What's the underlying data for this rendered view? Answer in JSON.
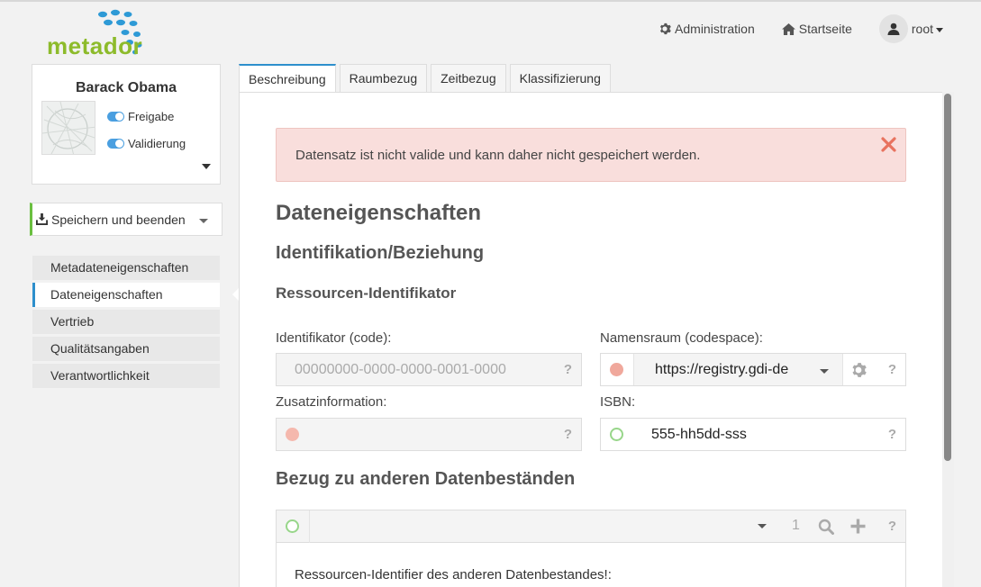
{
  "brand": {
    "name": "metador",
    "color": "#8dbb2b",
    "dot_color": "#2e9ad6"
  },
  "header": {
    "admin_label": "Administration",
    "home_label": "Startseite",
    "user_label": "root"
  },
  "profile": {
    "name": "Barack Obama",
    "toggle_release": "Freigabe",
    "toggle_validation": "Validierung"
  },
  "save_button": {
    "label": "Speichern und beenden"
  },
  "sidebar": {
    "items": [
      {
        "label": "Metadateneigenschaften"
      },
      {
        "label": "Dateneigenschaften"
      },
      {
        "label": "Vertrieb"
      },
      {
        "label": "Qualitätsangaben"
      },
      {
        "label": "Verantwortlichkeit"
      }
    ],
    "active_index": 1
  },
  "tabs": [
    {
      "label": "Beschreibung"
    },
    {
      "label": "Raumbezug"
    },
    {
      "label": "Zeitbezug"
    },
    {
      "label": "Klassifizierung"
    }
  ],
  "alert": {
    "message": "Datensatz ist nicht valide und kann daher nicht gespeichert werden.",
    "close": "✕"
  },
  "section": {
    "title": "Dateneigenschaften",
    "subtitle": "Identifikation/Beziehung",
    "group": "Ressourcen-Identifikator"
  },
  "fields": {
    "identifier": {
      "label": "Identifikator (code):",
      "placeholder": "00000000-0000-0000-0001-0000",
      "help": "?"
    },
    "namespace": {
      "label": "Namensraum (codespace):",
      "value": "https://registry.gdi-de",
      "help": "?"
    },
    "additional": {
      "label": "Zusatzinformation:",
      "help": "?"
    },
    "isbn": {
      "label": "ISBN:",
      "value": "555-hh5dd-sss",
      "help": "?"
    }
  },
  "relation": {
    "title": "Bezug zu anderen Datenbeständen",
    "count": "1",
    "help": "?",
    "hint": "Ressourcen-Identifier des anderen Datenbestandes!:"
  }
}
